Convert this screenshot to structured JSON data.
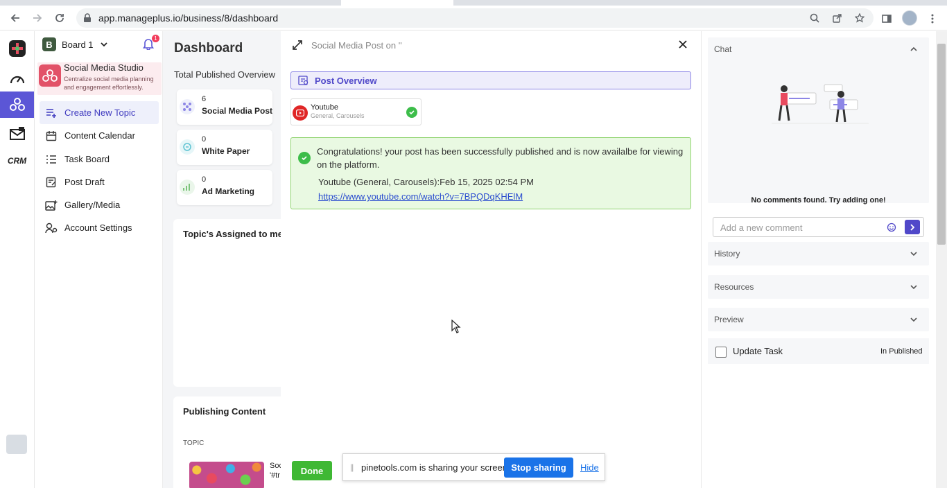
{
  "browser": {
    "url": "app.manageplus.io/business/8/dashboard"
  },
  "menu": {
    "board_badge": "B",
    "board_name": "Board 1",
    "notification_count": "1",
    "studio_title": "Social Media Studio",
    "studio_desc": "Centralize social media planning and engagement effortlessly.",
    "items": [
      {
        "label": "Create New Topic"
      },
      {
        "label": "Content Calendar"
      },
      {
        "label": "Task Board"
      },
      {
        "label": "Post Draft"
      },
      {
        "label": "Gallery/Media"
      },
      {
        "label": "Account Settings"
      }
    ]
  },
  "rail": {
    "crm_label": "CRM"
  },
  "dashboard": {
    "title": "Dashboard",
    "subtitle": "Total Published Overview",
    "stats": [
      {
        "count": "6",
        "label": "Social Media Post"
      },
      {
        "count": "0",
        "label": "White Paper"
      },
      {
        "count": "0",
        "label": "Ad Marketing"
      }
    ],
    "assigned_title": "Topic's Assigned to me",
    "publishing_title": "Publishing Content",
    "topic_column": "TOPIC",
    "row_text_1": "Soc",
    "row_text_2": "'#tr"
  },
  "modal": {
    "title": "Social Media Post on ''",
    "overview_label": "Post Overview",
    "platform_name": "Youtube",
    "platform_sub": "General, Carousels",
    "success_message": "Congratulations! your post has been successfully published and is now availalbe for viewing on the platform.",
    "published_when": "Youtube (General, Carousels):Feb 15, 2025 02:54 PM",
    "published_link": "https://www.youtube.com/watch?v=7BPQDqKHElM",
    "done_label": "Done"
  },
  "share_bar": {
    "text": "pinetools.com is sharing your screen.",
    "stop_label": "Stop sharing",
    "hide_label": "Hide"
  },
  "right_panel": {
    "chat_title": "Chat",
    "empty_text": "No comments found. Try adding one!",
    "comment_placeholder": "Add a new comment",
    "history_title": "History",
    "resources_title": "Resources",
    "preview_title": "Preview",
    "update_task_label": "Update Task",
    "status": "In Published"
  },
  "colors": {
    "primary": "#5048c9",
    "success": "#3fb834",
    "studio_accent": "#e25268",
    "youtube": "#e02626"
  }
}
